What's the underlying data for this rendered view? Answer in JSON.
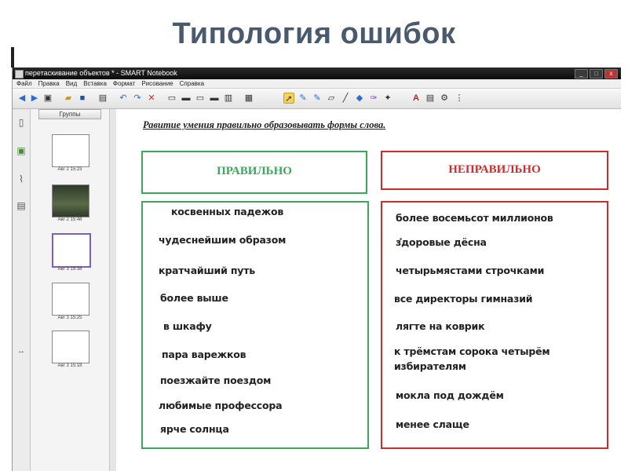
{
  "slide": {
    "title": "Типология  ошибок"
  },
  "app": {
    "window_title": "перетаскивание объектов * - SMART Notebook",
    "window_buttons": [
      "_",
      "□",
      "x"
    ],
    "menu": [
      "Файл",
      "Правка",
      "Вид",
      "Вставка",
      "Формат",
      "Рисование",
      "Справка"
    ],
    "toolbar_icons": [
      "back-icon",
      "forward-icon",
      "add-page-icon",
      "open-folder-icon",
      "save-icon",
      "paste-icon",
      "undo-icon",
      "redo-icon",
      "delete-icon",
      "screen-shade-icon",
      "display-icon",
      "capture-icon",
      "full-screen-icon",
      "dual-page-icon",
      "table-icon",
      "select-icon",
      "pen-icon",
      "creative-pen-icon",
      "eraser-icon",
      "line-icon",
      "shape-icon",
      "magic-pen-icon",
      "fill-icon",
      "text-icon",
      "properties-icon",
      "move-toolbar-icon"
    ],
    "sorter": {
      "groups_label": "Группы",
      "thumbnails": [
        {
          "caption": "Авг 2 15:23"
        },
        {
          "caption": "Авг 2 15:48"
        },
        {
          "caption": "Авг 3 15:38"
        },
        {
          "caption": "Авг 3 15:25"
        },
        {
          "caption": "Авг 3 15:18"
        }
      ]
    }
  },
  "content": {
    "heading": "Равитие умения правильно образовывать формы слова.",
    "correct": {
      "label": "ПРАВИЛЬНО",
      "items": [
        "косвенных падежов",
        "чудеснейшим образом",
        "кратчайший путь",
        "более выше",
        "в шкафу",
        "пара варежков",
        "поезжайте поездом",
        "любимые профессора",
        "ярче солнца"
      ]
    },
    "wrong": {
      "label": "НЕПРАВИЛЬНО",
      "items": [
        "более восемьсот миллионов",
        "здоровые дёсна",
        "четырьмястами строчками",
        "все директоры гимназий",
        "лягте на коврик",
        "к трёмстам сорока четырём",
        "избирателям",
        "мокла под дождём",
        "менее слаще"
      ]
    }
  },
  "colors": {
    "correct": "#39a85a",
    "wrong": "#d42a2a",
    "title": "#4a5a6e"
  }
}
